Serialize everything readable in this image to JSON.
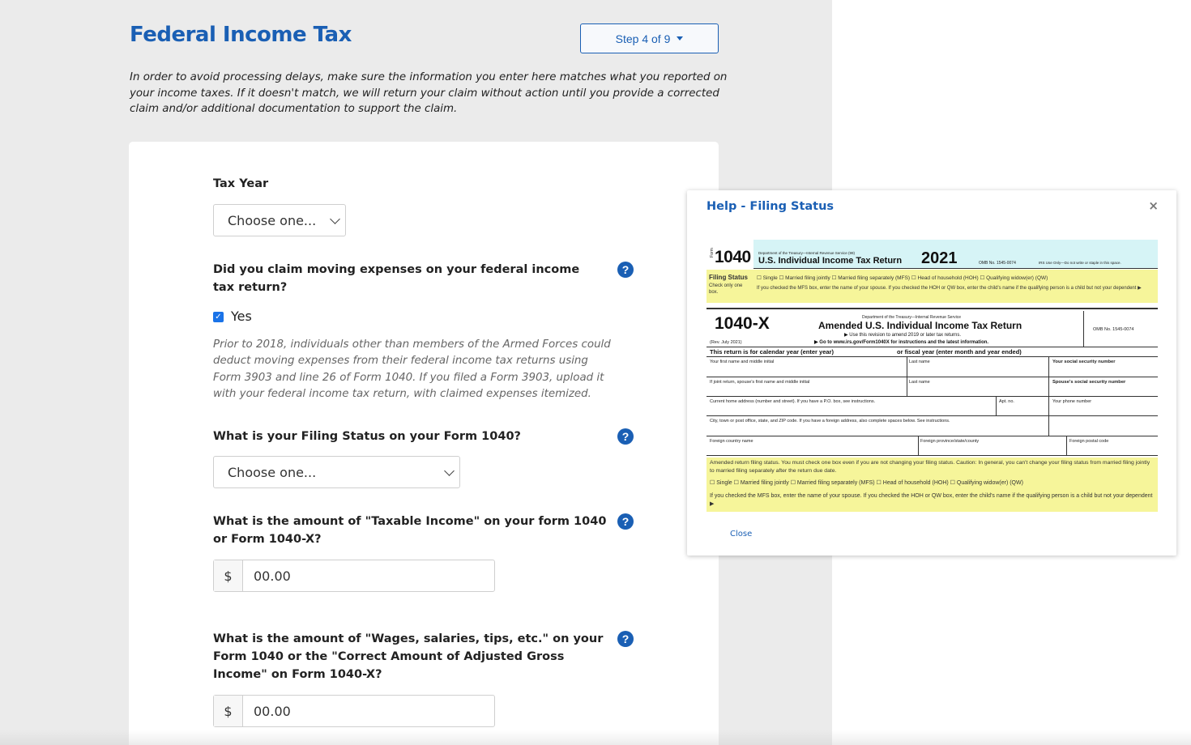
{
  "page": {
    "title": "Federal Income Tax",
    "step_label": "Step 4 of 9",
    "intro": "In order to avoid processing delays, make sure the information you enter here matches what you reported on your income taxes. If it doesn't match, we will return your claim without action until you provide a corrected claim and/or additional documentation to support the claim."
  },
  "form": {
    "tax_year": {
      "label": "Tax Year",
      "value": "Choose one..."
    },
    "moving": {
      "label": "Did you claim moving expenses on your federal income tax return?",
      "checkbox_label": "Yes",
      "checked": true,
      "note": "Prior to 2018, individuals other than members of the Armed Forces could deduct moving expenses from their federal income tax returns using Form 3903 and line 26 of Form 1040. If you filed a Form 3903, upload it with your federal income tax return, with claimed expenses itemized."
    },
    "filing_status": {
      "label": "What is your Filing Status on your Form 1040?",
      "value": "Choose one..."
    },
    "taxable_income": {
      "label": "What is the amount of \"Taxable Income\" on your form 1040 or Form 1040-X?",
      "currency": "$",
      "value": "00.00"
    },
    "wages": {
      "label": "What is the amount of \"Wages, salaries, tips, etc.\" on your Form 1040 or the \"Correct Amount of Adjusted Gross Income\" on Form 1040-X?",
      "currency": "$",
      "value": "00.00"
    },
    "help_glyph": "?"
  },
  "modal": {
    "title": "Help - Filing Status",
    "close_x": "×",
    "close_label": "Close",
    "form_image": {
      "form1040": "1040",
      "form_side": "Form",
      "dept1": "Department of the Treasury—Internal Revenue Service (99)",
      "title1": "U.S. Individual Income Tax Return",
      "year": "2021",
      "omb1": "OMB No. 1545-0074",
      "irs_use": "IRS Use Only—Do not write or staple in this space.",
      "filing_status": "Filing Status",
      "check_only": "Check only one box.",
      "opts1": "☐ Single   ☐ Married filing jointly   ☐ Married filing separately (MFS)   ☐ Head of household (HOH)   ☐ Qualifying widow(er) (QW)",
      "sub1": "If you checked the MFS box, enter the name of your spouse. If you checked the HOH or QW box, enter the child's name if the qualifying person is a child but not your dependent ▶",
      "form1040x": "1040-X",
      "dept2": "Department of the Treasury—Internal Revenue Service",
      "title2": "Amended U.S. Individual Income Tax Return",
      "rev1": "▶ Use this revision to amend 2019 or later tax returns.",
      "rev2": "▶ Go to www.irs.gov/Form1040X for instructions and the latest information.",
      "omb2": "OMB No. 1545-0074",
      "rev_date": "(Rev. July 2021)",
      "calendar": "This return is for calendar year (enter year)",
      "fiscal": "or fiscal year (enter month and year ended)",
      "first_name": "Your first name and middle initial",
      "last_name": "Last name",
      "ssn": "Your social security number",
      "spouse_first": "If joint return, spouse's first name and middle initial",
      "spouse_last": "Last name",
      "spouse_ssn": "Spouse's social security number",
      "address": "Current home address (number and street). If you have a P.O. box, see instructions.",
      "apt": "Apt. no.",
      "phone": "Your phone number",
      "city": "City, town or post office, state, and ZIP code. If you have a foreign address, also complete spaces below. See instructions.",
      "foreign_country": "Foreign country name",
      "foreign_province": "Foreign province/state/county",
      "foreign_postal": "Foreign postal code",
      "amended_status": "Amended return filing status. You must check one box even if you are not changing your filing status. Caution: In general, you can't change your filing status from married filing jointly to married filing separately after the return due date.",
      "opts2": "☐ Single     ☐ Married filing jointly     ☐ Married filing separately (MFS)     ☐ Head of household (HOH)     ☐ Qualifying widow(er) (QW)",
      "sub2": "If you checked the MFS box, enter the name of your spouse. If you checked the HOH or QW box, enter the child's name if the qualifying person is a child but not your dependent ▶"
    }
  },
  "colors": {
    "accent": "#1a5fb4",
    "highlight_yellow": "#f6f59a",
    "highlight_cyan": "#d6f4f6",
    "page_bg": "#ebebeb"
  }
}
